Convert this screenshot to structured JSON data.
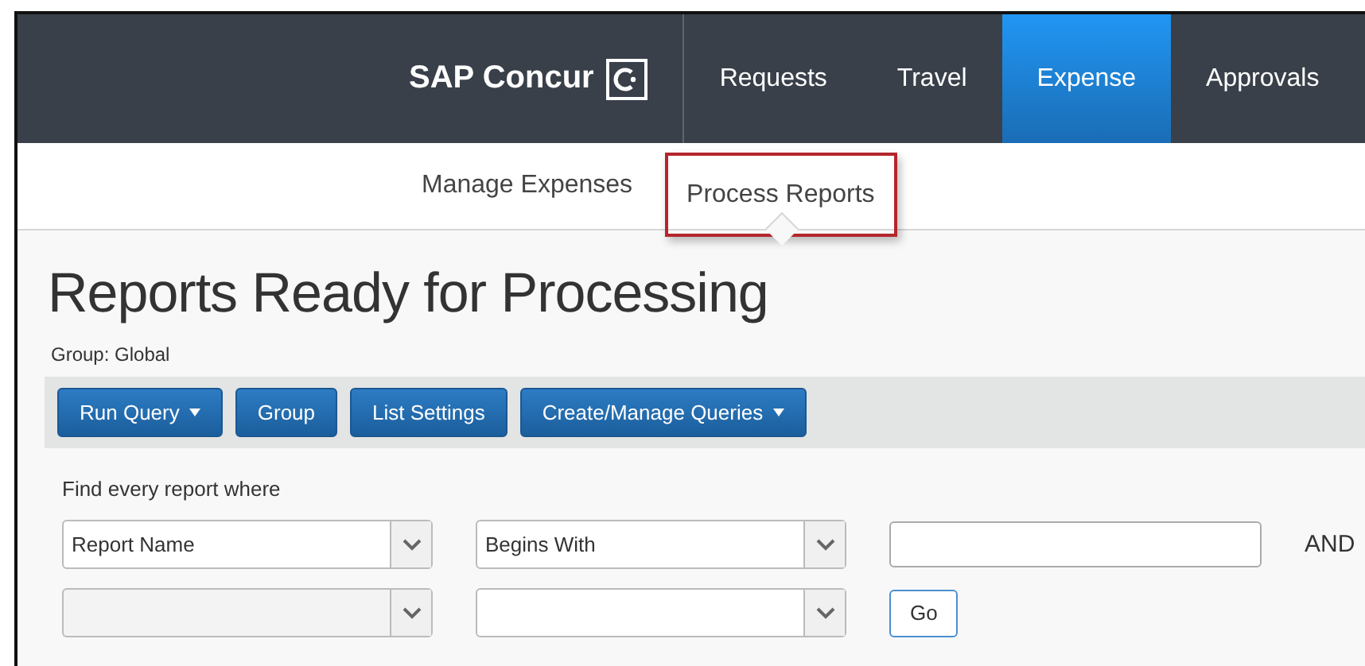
{
  "header": {
    "logo": "SAP Concur",
    "nav": [
      {
        "label": "Requests",
        "selected": false
      },
      {
        "label": "Travel",
        "selected": false
      },
      {
        "label": "Expense",
        "selected": true
      },
      {
        "label": "Approvals",
        "selected": false
      }
    ]
  },
  "subnav": [
    {
      "label": "Manage Expenses",
      "selected": false,
      "highlighted": false
    },
    {
      "label": "Process Reports",
      "selected": true,
      "highlighted": true
    }
  ],
  "page": {
    "title": "Reports Ready for Processing",
    "group": "Group: Global"
  },
  "toolbar": [
    {
      "label": "Run Query",
      "dropdown": true
    },
    {
      "label": "Group",
      "dropdown": false
    },
    {
      "label": "List Settings",
      "dropdown": false
    },
    {
      "label": "Create/Manage Queries",
      "dropdown": true
    }
  ],
  "query": {
    "intro": "Find every report where",
    "rows": [
      {
        "field": "Report Name",
        "operator": "Begins With",
        "value": "",
        "conjunction": "AND"
      },
      {
        "field": "",
        "operator": "",
        "value": "",
        "action": "Go"
      }
    ]
  }
}
